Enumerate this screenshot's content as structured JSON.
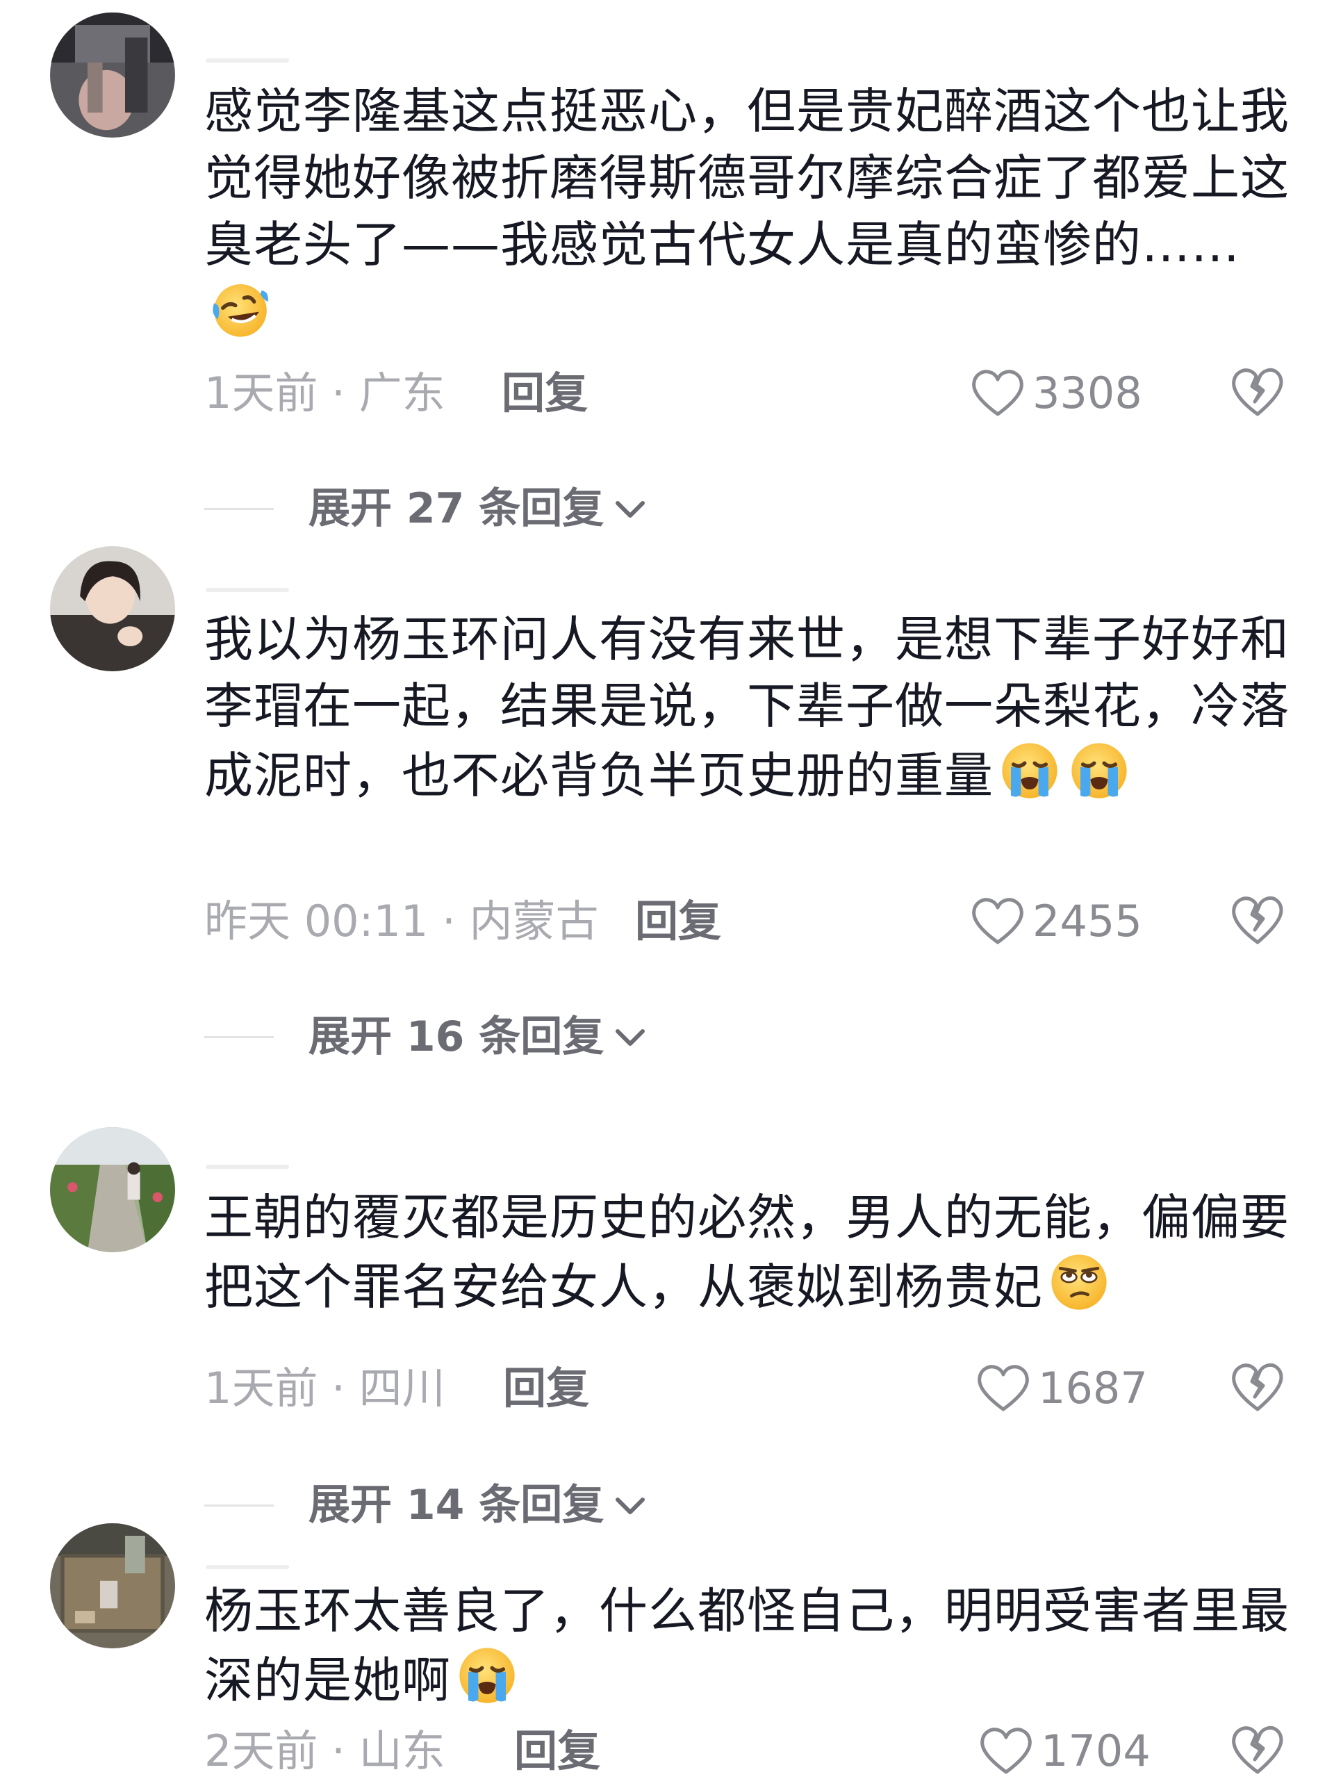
{
  "comments": [
    {
      "text": "感觉李隆基这点挺恶心，但是贵妃醉酒这个也让我觉得她好像被折磨得斯德哥尔摩综合症了都爱上这臭老头了——我感觉古代女人是真的蛮惨的……",
      "emoji": "rofl-emoji",
      "meta": "1天前 · 广东",
      "reply_label": "回复",
      "likes": "3308",
      "expand_label": "展开 27 条回复"
    },
    {
      "text": "我以为杨玉环问人有没有来世，是想下辈子好好和李瑁在一起，结果是说，下辈子做一朵梨花，冷落成泥时，也不必背负半页史册的重量",
      "emoji": "crying-emoji",
      "meta": "昨天 00:11 · 内蒙古",
      "reply_label": "回复",
      "likes": "2455",
      "expand_label": "展开 16 条回复"
    },
    {
      "text": "王朝的覆灭都是历史的必然，男人的无能，偏偏要把这个罪名安给女人，从褒姒到杨贵妃",
      "emoji": "eye-roll-emoji",
      "meta": "1天前 · 四川",
      "reply_label": "回复",
      "likes": "1687",
      "expand_label": "展开 14 条回复"
    },
    {
      "text": "杨玉环太善良了，什么都怪自己，明明受害者里最深的是她啊",
      "emoji": "crying-emoji",
      "meta": "2天前 · 山东",
      "reply_label": "回复",
      "likes": "1704"
    }
  ],
  "icons": {
    "like": "heart-outline-icon",
    "dislike": "broken-heart-icon",
    "expand": "chevron-down-icon"
  },
  "colors": {
    "text": "#161823",
    "meta": "#a9aab0",
    "action": "#6b6c73",
    "emoji_face": "#ffcc33",
    "emoji_tears": "#49a8ee"
  }
}
